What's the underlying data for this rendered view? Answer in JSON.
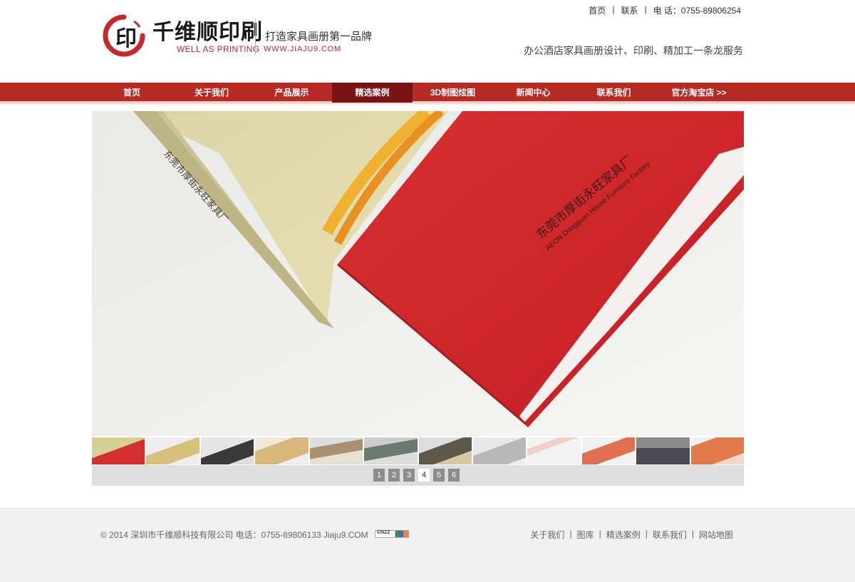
{
  "header": {
    "logo_brush_text": "千维顺印刷",
    "logo_en": "WELL AS PRINTING",
    "slogan": "打造家具画册第一品牌",
    "url": "WWW.JIAJU9.COM",
    "toplinks": [
      "首页",
      "联系",
      "电 话：0755-89806254"
    ],
    "tagline": "办公酒店家具画册设计、印刷、精加工一条龙服务"
  },
  "nav": {
    "items": [
      "首页",
      "关于我们",
      "产品展示",
      "精选案例",
      "3D制图炫图",
      "新闻中心",
      "联系我们",
      "官方淘宝店 >>"
    ],
    "active_index": 3
  },
  "slide": {
    "spine_text": "东莞市厚街永旺家具厂",
    "cover_cn": "东莞市厚街永旺家具厂",
    "cover_en": "AEON Dongguan House Furniture Factory"
  },
  "pager": {
    "pages": [
      "1",
      "2",
      "3",
      "4",
      "5",
      "6"
    ],
    "active_index": 3
  },
  "footer": {
    "copyright": "© 2014 深圳市千维顺科技有限公司 电话：0755-89806133 Jiaju9.COM",
    "cnzz_label": "CNZZ",
    "links": [
      "关于我们",
      "图库",
      "精选案例",
      "联系我们",
      "网站地图"
    ]
  },
  "colors": {
    "nav_bg": "#b72a23",
    "nav_active": "#7a1414",
    "brand_red": "#c8282a"
  }
}
